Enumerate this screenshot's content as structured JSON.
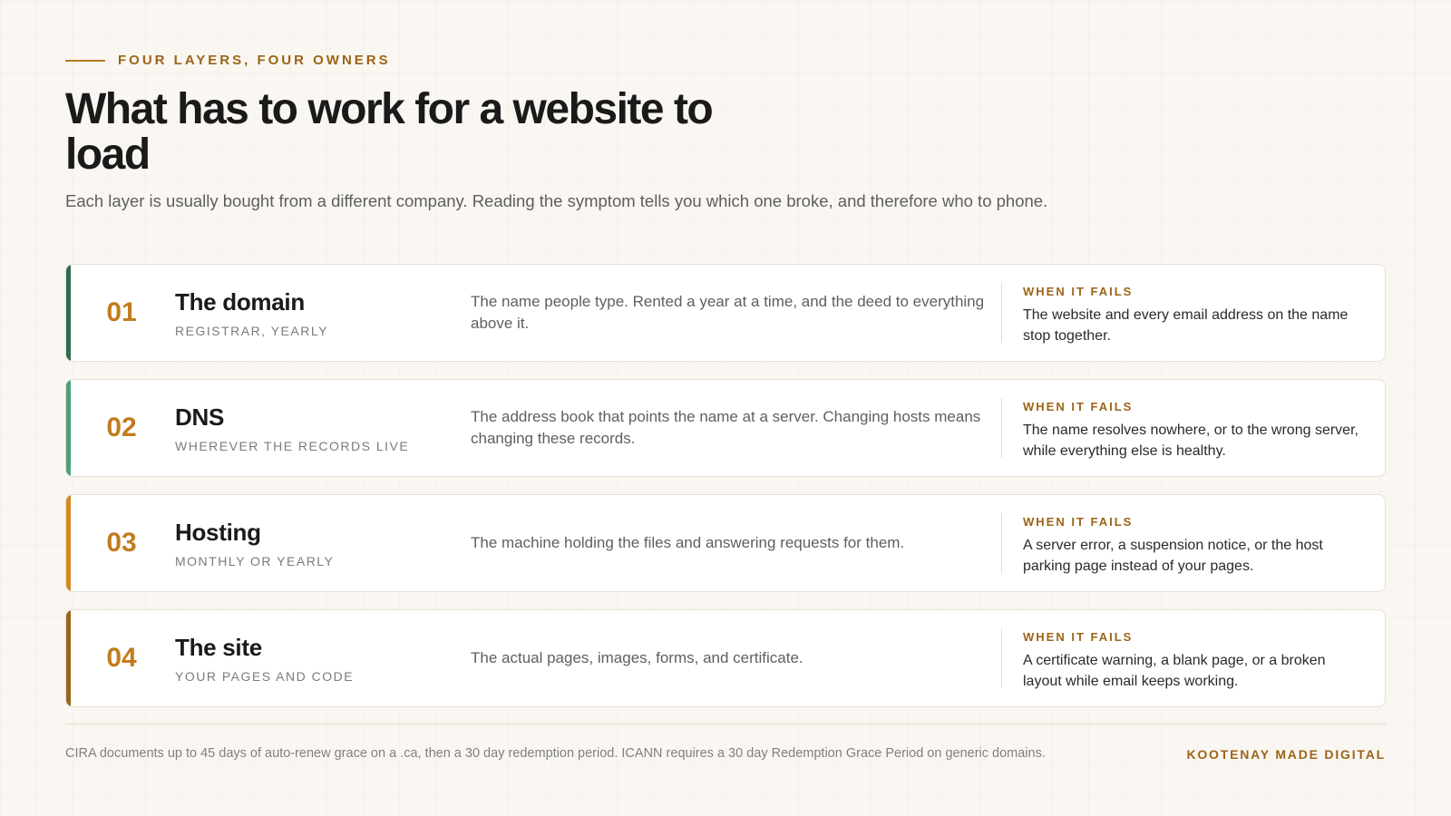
{
  "header": {
    "eyebrow": "FOUR LAYERS, FOUR OWNERS",
    "title": "What has to work for a website to load",
    "subtitle": "Each layer is usually bought from a different company. Reading the symptom tells you which one broke, and therefore who to phone."
  },
  "layers": [
    {
      "number": "01",
      "name": "The domain",
      "meta": "REGISTRAR, YEARLY",
      "description": "The name people type. Rented a year at a time, and the deed to everything above it.",
      "fail_label": "WHEN IT FAILS",
      "fail_text": "The website and every email address on the name stop together.",
      "accent_color": "#2f6b52"
    },
    {
      "number": "02",
      "name": "DNS",
      "meta": "WHEREVER THE RECORDS LIVE",
      "description": "The address book that points the name at a server. Changing hosts means changing these records.",
      "fail_label": "WHEN IT FAILS",
      "fail_text": "The name resolves nowhere, or to the wrong server, while everything else is healthy.",
      "accent_color": "#4f9c7c"
    },
    {
      "number": "03",
      "name": "Hosting",
      "meta": "MONTHLY OR YEARLY",
      "description": "The machine holding the files and answering requests for them.",
      "fail_label": "WHEN IT FAILS",
      "fail_text": "A server error, a suspension notice, or the host parking page instead of your pages.",
      "accent_color": "#d18a22"
    },
    {
      "number": "04",
      "name": "The site",
      "meta": "YOUR PAGES AND CODE",
      "description": "The actual pages, images, forms, and certificate.",
      "fail_label": "WHEN IT FAILS",
      "fail_text": "A certificate warning, a blank page, or a broken layout while email keeps working.",
      "accent_color": "#9a6420"
    }
  ],
  "footer": {
    "note": "CIRA documents up to 45 days of auto-renew grace on a .ca, then a 30 day redemption period. ICANN requires a 30 day Redemption Grace Period on generic domains.",
    "brand": "KOOTENAY MADE DIGITAL"
  }
}
